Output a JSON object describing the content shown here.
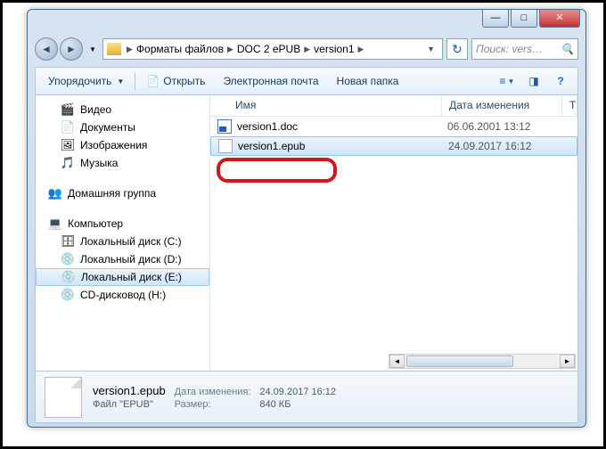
{
  "window": {
    "minimize": "—",
    "maximize": "□",
    "close": "✕"
  },
  "address": {
    "crumbs": [
      "Форматы файлов",
      "DOC 2 ePUB",
      "version1"
    ],
    "sep": "▶"
  },
  "search": {
    "placeholder": "Поиск: vers…"
  },
  "toolbar": {
    "organize": "Упорядочить",
    "open": "Открыть",
    "email": "Электронная почта",
    "newFolder": "Новая папка"
  },
  "sidebar": {
    "video": "Видео",
    "documents": "Документы",
    "pictures": "Изображения",
    "music": "Музыка",
    "homegroup": "Домашняя группа",
    "computer": "Компьютер",
    "driveC": "Локальный диск (C:)",
    "driveD": "Локальный диск (D:)",
    "driveE": "Локальный диск (E:)",
    "cdH": "CD-дисковод (H:)"
  },
  "columns": {
    "name": "Имя",
    "date": "Дата изменения",
    "type": "Т"
  },
  "files": [
    {
      "name": "version1.doc",
      "date": "06.06.2001 13:12"
    },
    {
      "name": "version1.epub",
      "date": "24.09.2017 16:12"
    }
  ],
  "details": {
    "filename": "version1.epub",
    "typeLine": "Файл \"EPUB\"",
    "dateLabel": "Дата изменения:",
    "dateVal": "24.09.2017 16:12",
    "sizeLabel": "Размер:",
    "sizeVal": "840 КБ"
  }
}
